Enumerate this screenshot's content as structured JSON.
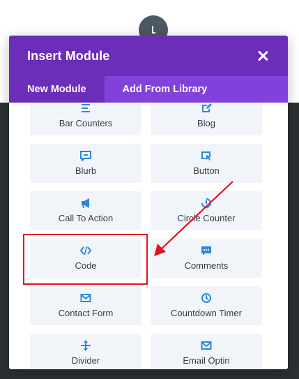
{
  "modal": {
    "title": "Insert Module",
    "close_icon": "close-x-icon"
  },
  "tabs": [
    {
      "label": "New Module",
      "active": true
    },
    {
      "label": "Add From Library",
      "active": false
    }
  ],
  "modules": [
    {
      "label": "Bar Counters",
      "icon": "bars-icon"
    },
    {
      "label": "Blog",
      "icon": "edit-icon"
    },
    {
      "label": "Blurb",
      "icon": "message-icon"
    },
    {
      "label": "Button",
      "icon": "cursor-icon"
    },
    {
      "label": "Call To Action",
      "icon": "megaphone-icon"
    },
    {
      "label": "Circle Counter",
      "icon": "circle-counter-icon"
    },
    {
      "label": "Code",
      "icon": "code-icon"
    },
    {
      "label": "Comments",
      "icon": "comments-icon"
    },
    {
      "label": "Contact Form",
      "icon": "envelope-icon"
    },
    {
      "label": "Countdown Timer",
      "icon": "timer-icon"
    },
    {
      "label": "Divider",
      "icon": "divider-icon"
    },
    {
      "label": "Email Optin",
      "icon": "envelope-icon"
    }
  ],
  "colors": {
    "header": "#6c2eb9",
    "tabs_bar": "#8341db",
    "module_bg": "#f1f5f9",
    "icon": "#2b87da",
    "annotation": "#e4121c"
  }
}
